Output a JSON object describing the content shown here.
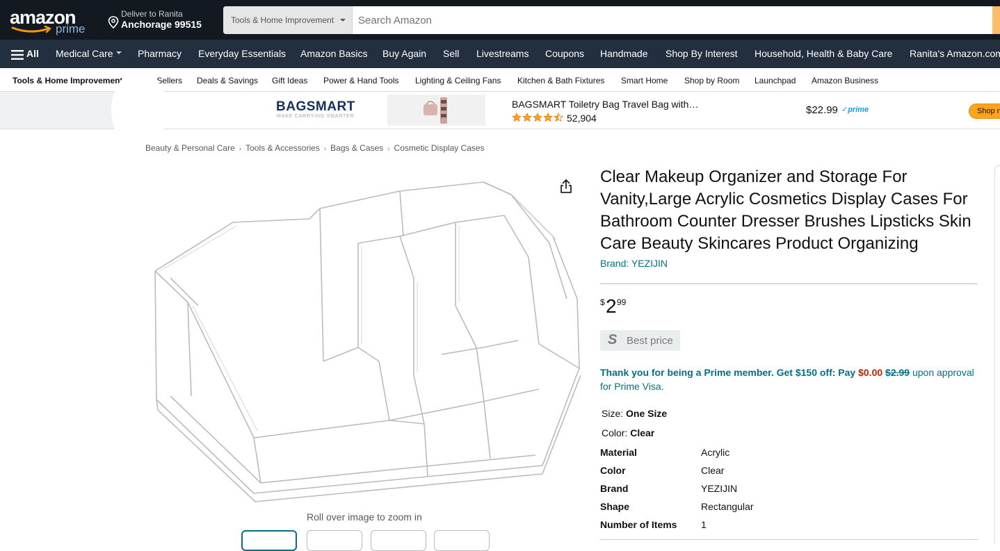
{
  "header": {
    "logo_text": "amazon",
    "logo_sub": "prime",
    "deliver_line1": "Deliver to Ranita",
    "deliver_line2": "Anchorage 99515",
    "search_dept": "Tools & Home Improvement",
    "search_placeholder": "Search Amazon",
    "search_value": ""
  },
  "nav": {
    "all_label": "All",
    "items": [
      {
        "label": "Medical Care",
        "dropdown": true
      },
      {
        "label": "Pharmacy"
      },
      {
        "label": "Everyday Essentials"
      },
      {
        "label": "Amazon Basics"
      },
      {
        "label": "Buy Again"
      },
      {
        "label": "Sell"
      },
      {
        "label": "Livestreams"
      },
      {
        "label": "Coupons"
      },
      {
        "label": "Handmade"
      },
      {
        "label": "Shop By Interest"
      },
      {
        "label": "Household, Health & Baby Care"
      },
      {
        "label": "Ranita's Amazon.com"
      }
    ]
  },
  "subnav": {
    "items": [
      {
        "label": "Tools & Home Improvement"
      },
      {
        "label": "Best Sellers"
      },
      {
        "label": "Deals & Savings"
      },
      {
        "label": "Gift Ideas"
      },
      {
        "label": "Power & Hand Tools"
      },
      {
        "label": "Lighting & Ceiling Fans"
      },
      {
        "label": "Kitchen & Bath Fixtures"
      },
      {
        "label": "Smart Home"
      },
      {
        "label": "Shop by Room"
      },
      {
        "label": "Launchpad"
      },
      {
        "label": "Amazon Business"
      }
    ]
  },
  "ad": {
    "brand": "BAGSMART",
    "brand_tagline": "MAKE CARRYING SMARTER",
    "title": "BAGSMART Toiletry Bag Travel Bag with…",
    "rating": 4.5,
    "rating_count": "52,904",
    "price": "$22.99",
    "prime_label": "✓prime",
    "shop_button": "Shop now"
  },
  "breadcrumb": [
    "Beauty & Personal Care",
    "Tools & Accessories",
    "Bags & Cases",
    "Cosmetic Display Cases"
  ],
  "gallery": {
    "zoom_hint": "Roll over image to zoom in",
    "thumbnail_count": 4,
    "active_thumbnail": 1
  },
  "product": {
    "title": "Clear Makeup Organizer and Storage For Vanity,Large Acrylic Cosmetics Display Cases For Bathroom Counter Dresser Brushes Lipsticks Skin Care Beauty Skincares Product Organizing",
    "brand_link": "Brand: YEZIJIN",
    "price_symbol": "$",
    "price_whole": "2",
    "price_fraction": "99",
    "best_price_icon": "S",
    "best_price_label": "Best price",
    "promo": {
      "text1": "Thank you for being a Prime member. Get $150 off: Pay ",
      "pay_amount": "$0.00",
      "original": "$2.99",
      "text2": " upon approval for Prime Visa."
    },
    "size_label": "Size: ",
    "size_value": "One Size",
    "color_label": "Color: ",
    "color_value": "Clear",
    "specs": [
      {
        "label": "Material",
        "value": "Acrylic"
      },
      {
        "label": "Color",
        "value": "Clear"
      },
      {
        "label": "Brand",
        "value": "YEZIJIN"
      },
      {
        "label": "Shape",
        "value": "Rectangular"
      },
      {
        "label": "Number of Items",
        "value": "1"
      }
    ]
  },
  "colors": {
    "header_bg": "#131921",
    "nav_bg": "#232f3e",
    "link": "#007185",
    "price_red": "#b12704",
    "search_button": "#febd69"
  }
}
